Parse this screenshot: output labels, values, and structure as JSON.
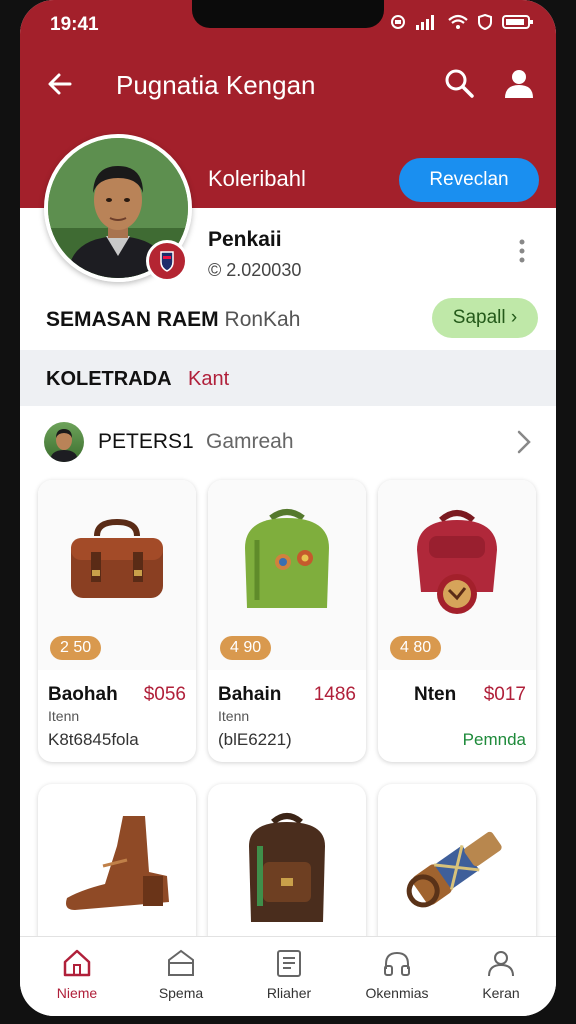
{
  "status": {
    "time": "19:41"
  },
  "topbar": {
    "title": "Pugnatia Kengan"
  },
  "profile": {
    "store_name": "Koleribahl",
    "follow_label": "Reveclan",
    "person_name": "Penkaii",
    "count": "© 2.020030"
  },
  "section": {
    "title": "SEMASAN RAEM",
    "subtitle": "RonKah",
    "action": "Sapall"
  },
  "band": {
    "title": "KOLETRADA",
    "subtitle": "Kant"
  },
  "seller": {
    "name": "PETERS1",
    "subtitle": "Gamreah"
  },
  "products": [
    {
      "tag": "2 50",
      "name": "Baohah",
      "price": "$056",
      "type": "Itenn",
      "code": "K8t6845fola",
      "extra": ""
    },
    {
      "tag": "4 90",
      "name": "Bahain",
      "price": "1486",
      "type": "Itenn",
      "code": "(blE6221)",
      "extra": ""
    },
    {
      "tag": "4 80",
      "name": "Nten",
      "price": "$017",
      "type": "",
      "code": "",
      "extra": "Pemnda"
    }
  ],
  "nav": [
    {
      "label": "Nieme",
      "icon": "home-icon"
    },
    {
      "label": "Spema",
      "icon": "store-icon"
    },
    {
      "label": "Rliaher",
      "icon": "document-icon"
    },
    {
      "label": "Okenmias",
      "icon": "headphones-icon"
    },
    {
      "label": "Keran",
      "icon": "profile-icon"
    }
  ],
  "colors": {
    "header": "#a3202b",
    "accent": "#b0203a",
    "follow": "#1a8ff0",
    "green": "#bfe8a8"
  }
}
